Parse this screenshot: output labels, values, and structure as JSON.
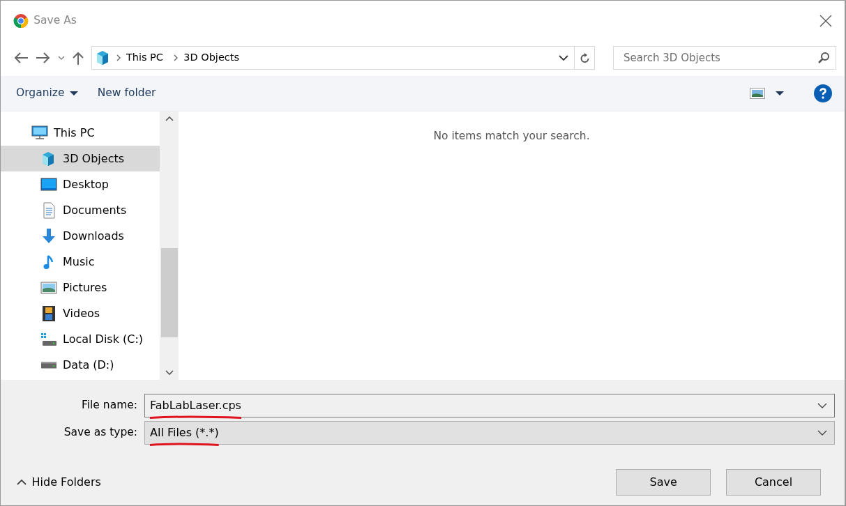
{
  "window": {
    "title": "Save As"
  },
  "nav": {
    "path": [
      "This PC",
      "3D Objects"
    ],
    "search": {
      "placeholder": "Search 3D Objects"
    }
  },
  "toolbar": {
    "items": [
      {
        "label": "Organize",
        "kind": "menu"
      },
      {
        "label": "New folder",
        "kind": "button"
      }
    ]
  },
  "sidebar": {
    "items": [
      {
        "label": "This PC",
        "selected": false,
        "children": [
          {
            "label": "3D Objects",
            "selected": true
          },
          {
            "label": "Desktop",
            "selected": false
          },
          {
            "label": "Documents",
            "selected": false
          },
          {
            "label": "Downloads",
            "selected": false
          },
          {
            "label": "Music",
            "selected": false
          },
          {
            "label": "Pictures",
            "selected": false
          },
          {
            "label": "Videos",
            "selected": false
          },
          {
            "label": "Local Disk (C:)",
            "selected": false
          },
          {
            "label": "Data (D:)",
            "selected": false
          }
        ]
      }
    ]
  },
  "content": {
    "message": "No items match your search."
  },
  "form": {
    "fields": [
      {
        "label": "File name:",
        "value": "FabLabLaser.cps",
        "kind": "combo",
        "annotated": true
      },
      {
        "label": "Save as type:",
        "value": "All Files (*.*)",
        "kind": "select",
        "annotated": true
      }
    ]
  },
  "footer": {
    "toggle": "Hide Folders",
    "buttons": [
      {
        "label": "Save"
      },
      {
        "label": "Cancel"
      }
    ]
  }
}
